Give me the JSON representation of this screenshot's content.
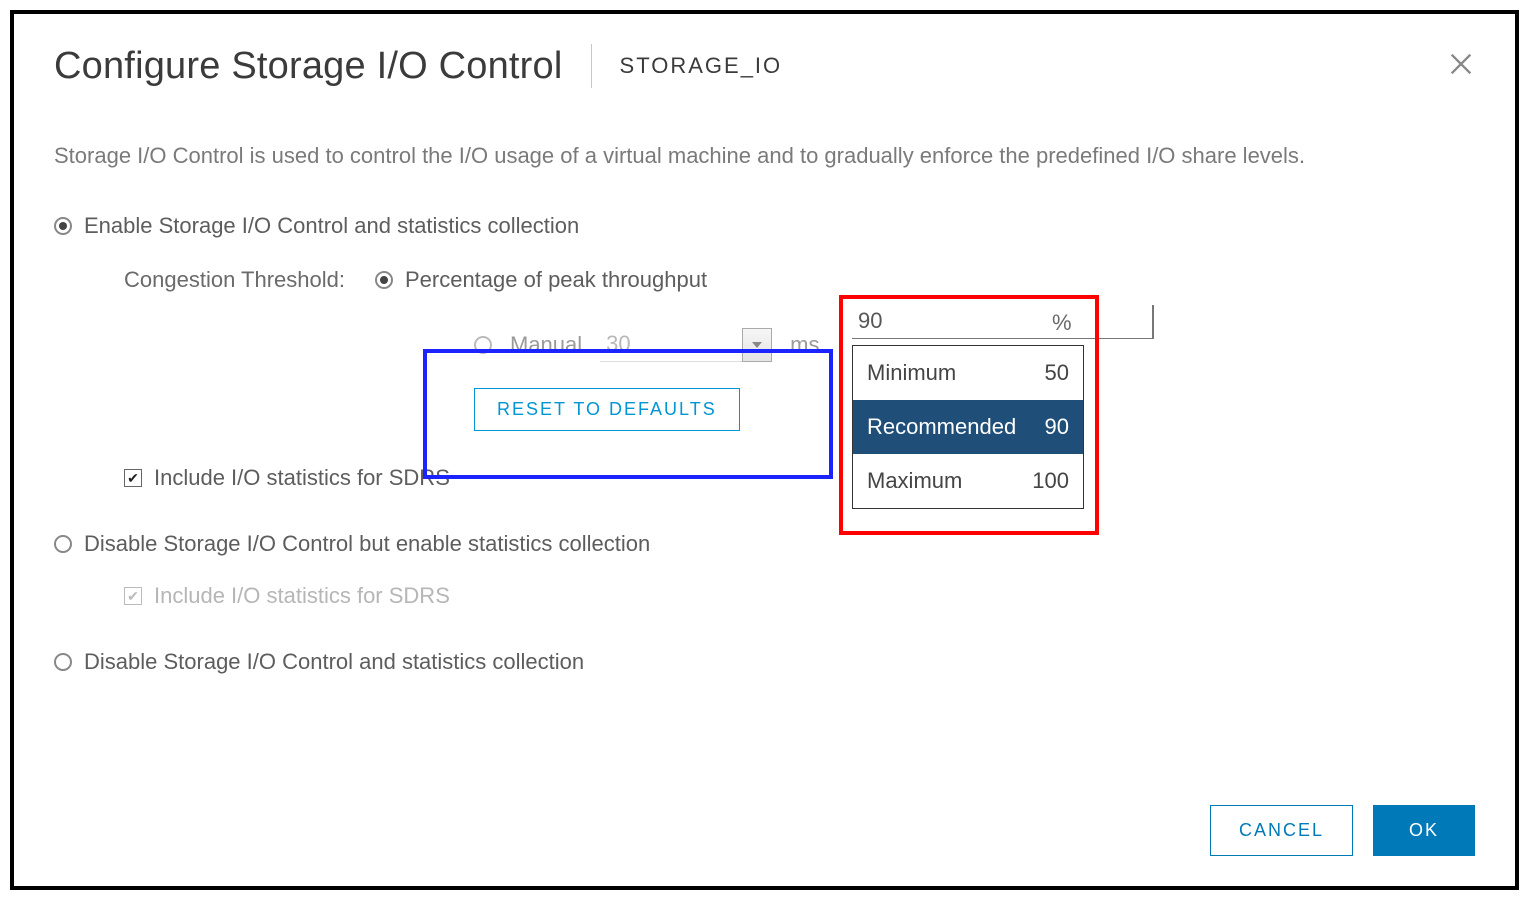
{
  "header": {
    "title": "Configure Storage I/O Control",
    "subtitle": "STORAGE_IO"
  },
  "description": "Storage I/O Control is used to control the I/O usage of a virtual machine and to gradually enforce the predefined I/O share levels.",
  "options": {
    "enable_label": "Enable Storage I/O Control and statistics collection",
    "disable_stats_label": "Disable Storage I/O Control but enable statistics collection",
    "disable_all_label": "Disable Storage I/O Control and statistics collection",
    "include_stats_label": "Include I/O statistics for SDRS"
  },
  "congestion": {
    "label": "Congestion Threshold:",
    "percentage_label": "Percentage of peak throughput",
    "percentage_value": "90",
    "percentage_unit": "%",
    "manual_label": "Manual",
    "manual_value": "30",
    "manual_unit": "ms",
    "reset_label": "RESET TO DEFAULTS"
  },
  "dropdown": {
    "items": [
      {
        "label": "Minimum",
        "value": "50"
      },
      {
        "label": "Recommended",
        "value": "90"
      },
      {
        "label": "Maximum",
        "value": "100"
      }
    ]
  },
  "footer": {
    "cancel": "CANCEL",
    "ok": "OK"
  }
}
